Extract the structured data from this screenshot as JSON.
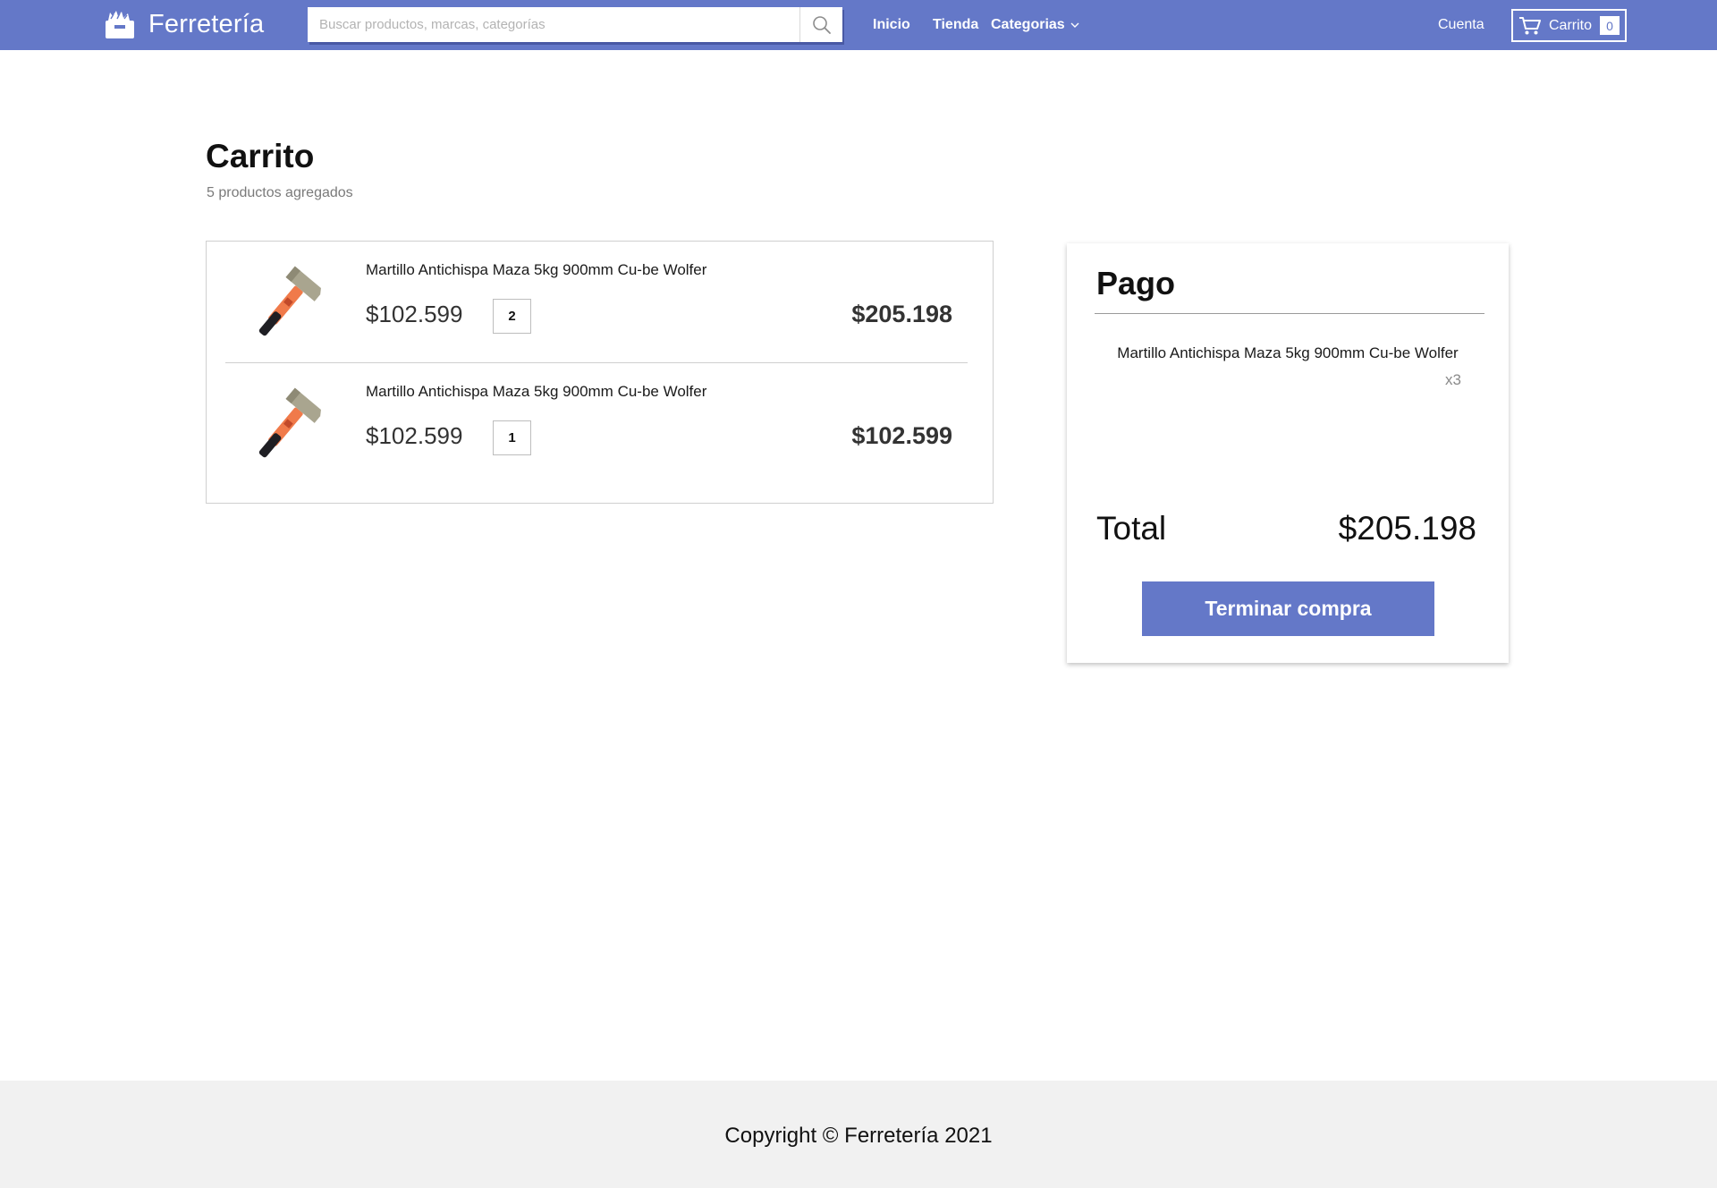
{
  "header": {
    "brand_name": "Ferretería",
    "search_placeholder": "Buscar productos, marcas, categorías",
    "nav": {
      "inicio": "Inicio",
      "tienda": "Tienda",
      "categorias": "Categorias"
    },
    "account_label": "Cuenta",
    "cart_label": "Carrito",
    "cart_count": "0"
  },
  "page": {
    "title": "Carrito",
    "subtitle": "5 productos agregados"
  },
  "cart": {
    "items": [
      {
        "name": "Martillo Antichispa Maza 5kg 900mm Cu-be Wolfer",
        "unit_price": "$102.599",
        "quantity": "2",
        "subtotal": "$205.198"
      },
      {
        "name": "Martillo Antichispa Maza 5kg 900mm Cu-be Wolfer",
        "unit_price": "$102.599",
        "quantity": "1",
        "subtotal": "$102.599"
      }
    ]
  },
  "payment": {
    "title": "Pago",
    "summary_item_name": "Martillo Antichispa Maza 5kg 900mm Cu-be Wolfer",
    "summary_item_qty": "x3",
    "total_label": "Total",
    "total_value": "$205.198",
    "checkout_label": "Terminar compra"
  },
  "footer": {
    "copyright": "Copyright © Ferretería 2021"
  },
  "colors": {
    "accent": "#6478c8",
    "footer_bg": "#f1f1f1"
  },
  "icons": {
    "brand": "toolbox-icon",
    "search": "search-icon",
    "cart": "cart-icon",
    "chevron": "chevron-down-icon",
    "product": "hammer-icon"
  }
}
